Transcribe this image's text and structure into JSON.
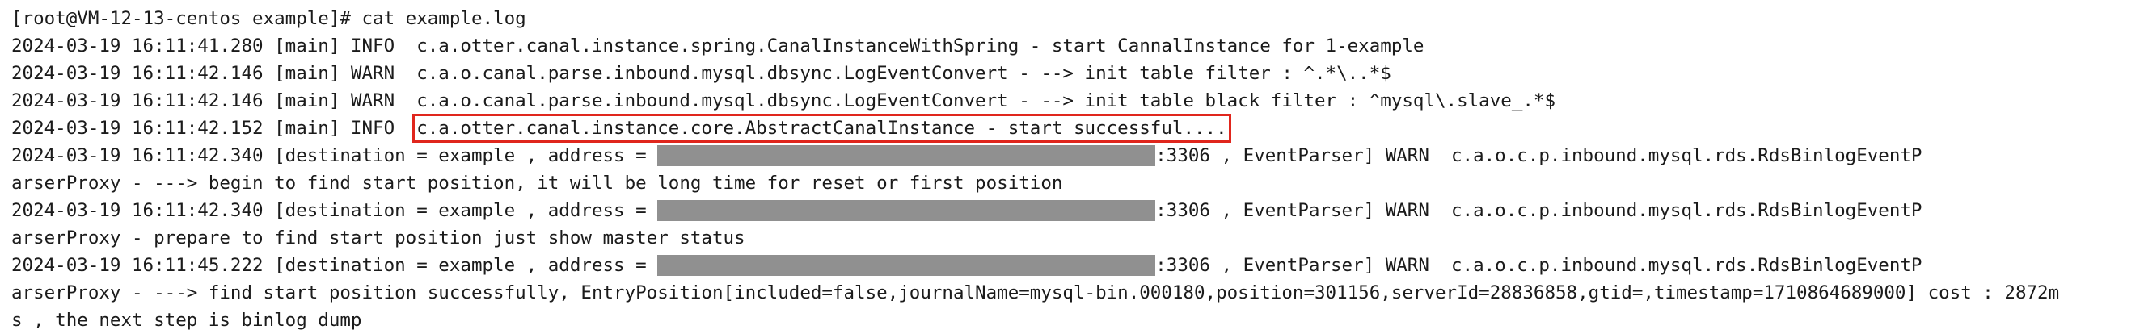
{
  "terminal": {
    "prompt": "[root@VM-12-13-centos example]# cat example.log",
    "lines": [
      {
        "text": "2024-03-19 16:11:41.280 [main] INFO  c.a.otter.canal.instance.spring.CanalInstanceWithSpring - start CannalInstance for 1-example"
      },
      {
        "text": "2024-03-19 16:11:42.146 [main] WARN  c.a.o.canal.parse.inbound.mysql.dbsync.LogEventConvert - --> init table filter : ^.*\\..*$"
      },
      {
        "text": "2024-03-19 16:11:42.146 [main] WARN  c.a.o.canal.parse.inbound.mysql.dbsync.LogEventConvert - --> init table black filter : ^mysql\\.slave_.*$"
      },
      {
        "prefix": "2024-03-19 16:11:42.152 [main] INFO  ",
        "highlighted": "c.a.otter.canal.instance.core.AbstractCanalInstance - start successful...."
      },
      {
        "prefix": "2024-03-19 16:11:42.340 [destination = example , address = ",
        "suffix": ":3306 , EventParser] WARN  c.a.o.c.p.inbound.mysql.rds.RdsBinlogEventP"
      },
      {
        "text": "arserProxy - ---> begin to find start position, it will be long time for reset or first position"
      },
      {
        "prefix": "2024-03-19 16:11:42.340 [destination = example , address = ",
        "suffix": ":3306 , EventParser] WARN  c.a.o.c.p.inbound.mysql.rds.RdsBinlogEventP"
      },
      {
        "text": "arserProxy - prepare to find start position just show master status"
      },
      {
        "prefix": "2024-03-19 16:11:45.222 [destination = example , address = ",
        "suffix": ":3306 , EventParser] WARN  c.a.o.c.p.inbound.mysql.rds.RdsBinlogEventP"
      },
      {
        "text": "arserProxy - ---> find start position successfully, EntryPosition[included=false,journalName=mysql-bin.000180,position=301156,serverId=28836858,gtid=,timestamp=1710864689000] cost : 2872m"
      },
      {
        "text": "s , the next step is binlog dump"
      }
    ]
  },
  "colors": {
    "background": "#ffffff",
    "text": "#1b1b1b",
    "highlight_border": "#e0261d",
    "redaction": "#8a8a8a"
  }
}
